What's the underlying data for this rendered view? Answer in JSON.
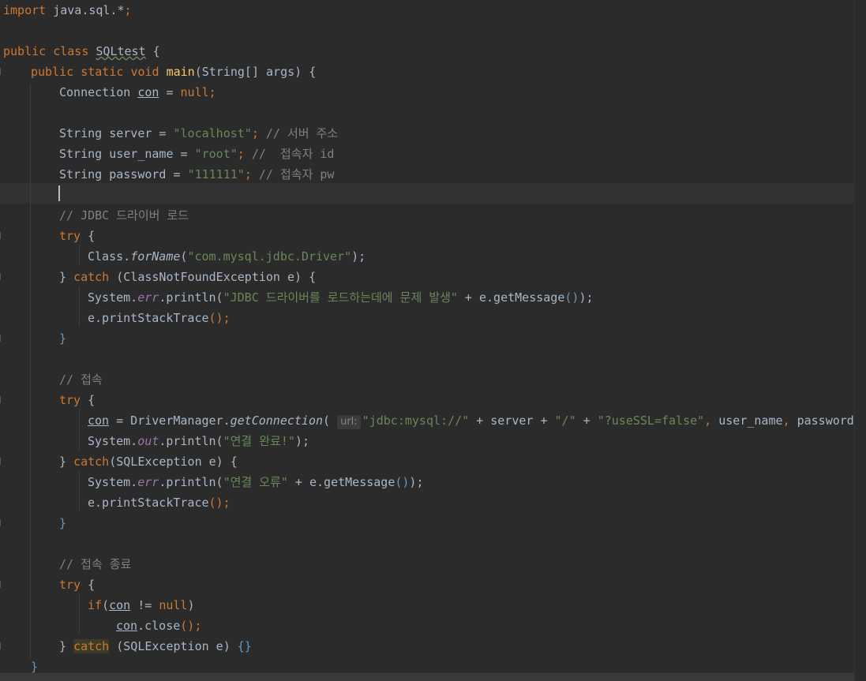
{
  "editor": {
    "language": "java",
    "file_class": "SQLtest",
    "lines": {
      "l1": [
        "import",
        " java.sql.*",
        ";"
      ],
      "l3": [
        "public",
        " ",
        "class",
        " ",
        "SQLtest",
        " {"
      ],
      "l4": [
        "public",
        " ",
        "static",
        " ",
        "void",
        " ",
        "main",
        "(String[] args) {"
      ],
      "l5": [
        "Connection ",
        "con",
        " = ",
        "null",
        ";"
      ],
      "l7": [
        "String server = ",
        "\"localhost\"",
        "; ",
        "// 서버 주소"
      ],
      "l8": [
        "String user_name = ",
        "\"root\"",
        "; ",
        "//  접속자 id"
      ],
      "l9": [
        "String password = ",
        "\"111111\"",
        "; ",
        "// 접속자 pw"
      ],
      "l11": [
        "// JDBC 드라이버 로드"
      ],
      "l12": [
        "try",
        " {"
      ],
      "l13": [
        "Class.",
        "forName",
        "(",
        "\"com.mysql.jdbc.Driver\"",
        ");"
      ],
      "l14": [
        "} ",
        "catch",
        " (ClassNotFoundException e) {"
      ],
      "l15": [
        "System.",
        "err",
        ".println(",
        "\"JDBC 드라이버를 로드하는데에 문제 발생\"",
        " + e.getMessage",
        "()",
        ");"
      ],
      "l16": [
        "e.printStackTrace",
        "()",
        ";"
      ],
      "l17": [
        "}"
      ],
      "l19": [
        "// 접속"
      ],
      "l20": [
        "try",
        " {"
      ],
      "l21": [
        "con",
        " = DriverManager.",
        "getConnection",
        "( ",
        "url:",
        "\"jdbc:mysql://\"",
        " + server + ",
        "\"/\"",
        " + ",
        "\"?useSSL=false\"",
        ", ",
        "user_name",
        ", ",
        "password);"
      ],
      "l22": [
        "System.",
        "out",
        ".println(",
        "\"연결 완료!\"",
        ");"
      ],
      "l23": [
        "} ",
        "catch",
        "(SQLException e) {"
      ],
      "l24": [
        "System.",
        "err",
        ".println(",
        "\"연결 오류\"",
        " + e.getMessage",
        "()",
        ");"
      ],
      "l25": [
        "e.printStackTrace",
        "()",
        ";"
      ],
      "l26": [
        "}"
      ],
      "l28": [
        "// 접속 종료"
      ],
      "l29": [
        "try",
        " {"
      ],
      "l30": [
        "if",
        "(",
        "con",
        " != ",
        "null",
        ")"
      ],
      "l31": [
        "con",
        ".close",
        "()",
        ";"
      ],
      "l32": [
        "} ",
        "catch",
        " (SQLException e) ",
        "{}"
      ],
      "l33": [
        "}"
      ]
    }
  },
  "colors": {
    "background": "#2b2b2b",
    "keyword": "#cc7832",
    "string": "#6a8759",
    "comment": "#808080",
    "method": "#ffc66d",
    "field": "#9876aa",
    "text": "#a9b7c6"
  }
}
